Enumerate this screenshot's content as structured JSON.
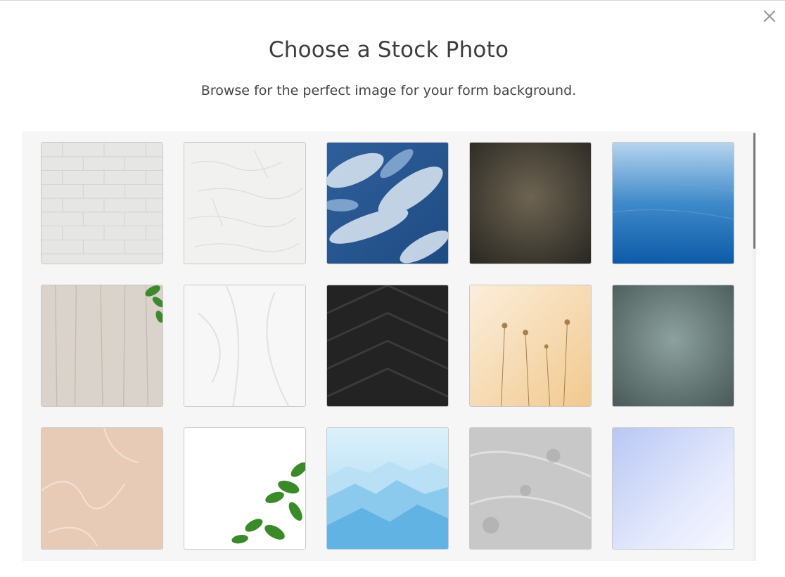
{
  "modal": {
    "title": "Choose a Stock Photo",
    "subtitle": "Browse for the perfect image for your form background."
  },
  "icons": {
    "close": "close-icon"
  },
  "photos": [
    {
      "name": "white-brick-wall-photo"
    },
    {
      "name": "white-plaster-texture-photo"
    },
    {
      "name": "blue-clouds-photo"
    },
    {
      "name": "dark-brown-grunge-photo"
    },
    {
      "name": "blue-water-gradient-photo"
    },
    {
      "name": "light-wood-leaves-photo"
    },
    {
      "name": "white-fabric-photo"
    },
    {
      "name": "black-chevron-wood-photo"
    },
    {
      "name": "golden-wildflowers-photo"
    },
    {
      "name": "teal-concrete-photo"
    },
    {
      "name": "beige-stone-photo"
    },
    {
      "name": "white-with-green-leaves-photo"
    },
    {
      "name": "blue-misty-mountains-photo"
    },
    {
      "name": "gray-marble-photo"
    },
    {
      "name": "lavender-gradient-photo"
    }
  ]
}
